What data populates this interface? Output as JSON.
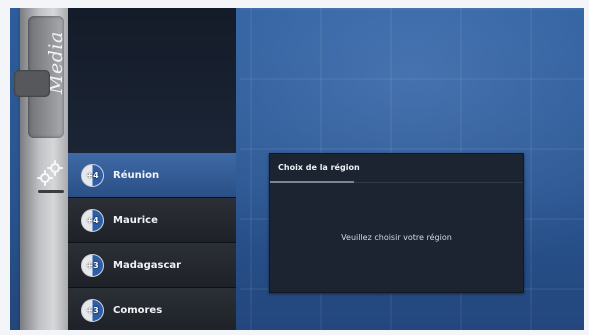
{
  "brand": {
    "logo_text": "Media"
  },
  "sidebar": {
    "settings_icon": "gear-icon"
  },
  "regions": [
    {
      "badge": "+4",
      "label": "Réunion",
      "selected": true
    },
    {
      "badge": "+4",
      "label": "Maurice",
      "selected": false
    },
    {
      "badge": "+3",
      "label": "Madagascar",
      "selected": false
    },
    {
      "badge": "+3",
      "label": "Comores",
      "selected": false
    }
  ],
  "dialog": {
    "title": "Choix de la région",
    "message": "Veuillez choisir votre région"
  },
  "colors": {
    "background": "#2a5590",
    "selected_item": "#3f6aa6",
    "list_item": "#24282e",
    "dialog": "#1c2431"
  }
}
